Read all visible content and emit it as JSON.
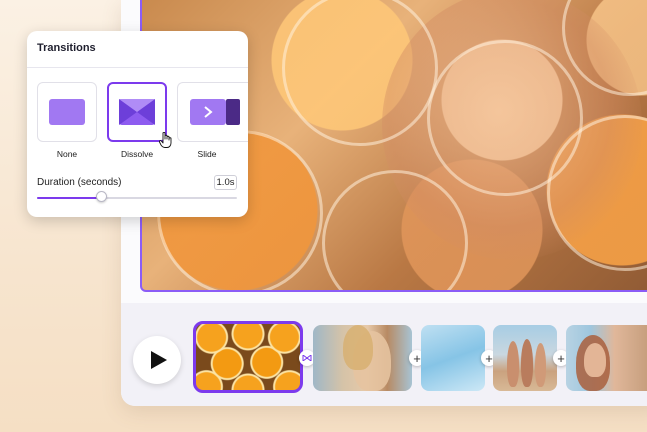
{
  "panel": {
    "title": "Transitions",
    "options": [
      {
        "label": "None",
        "icon": "none-transition-icon"
      },
      {
        "label": "Dissolve",
        "icon": "dissolve-transition-icon",
        "selected": true
      },
      {
        "label": "Slide",
        "icon": "slide-transition-icon"
      }
    ],
    "duration": {
      "label": "Duration (seconds)",
      "value": "1.0s",
      "slider_fraction": 0.32
    }
  },
  "timeline": {
    "clips": [
      {
        "name": "oranges-clip",
        "selected": true
      },
      {
        "name": "woman-smiling-clip"
      },
      {
        "name": "sky-clip"
      },
      {
        "name": "friends-beach-clip"
      },
      {
        "name": "portrait-clip"
      }
    ],
    "add_symbol": "+"
  },
  "colors": {
    "accent": "#7c3aed",
    "panel_bg": "#ffffff",
    "page_bg": "#f7e5cf"
  },
  "icons": [
    "play-icon",
    "cursor-hand-icon",
    "transition-link-icon",
    "plus-icon"
  ]
}
